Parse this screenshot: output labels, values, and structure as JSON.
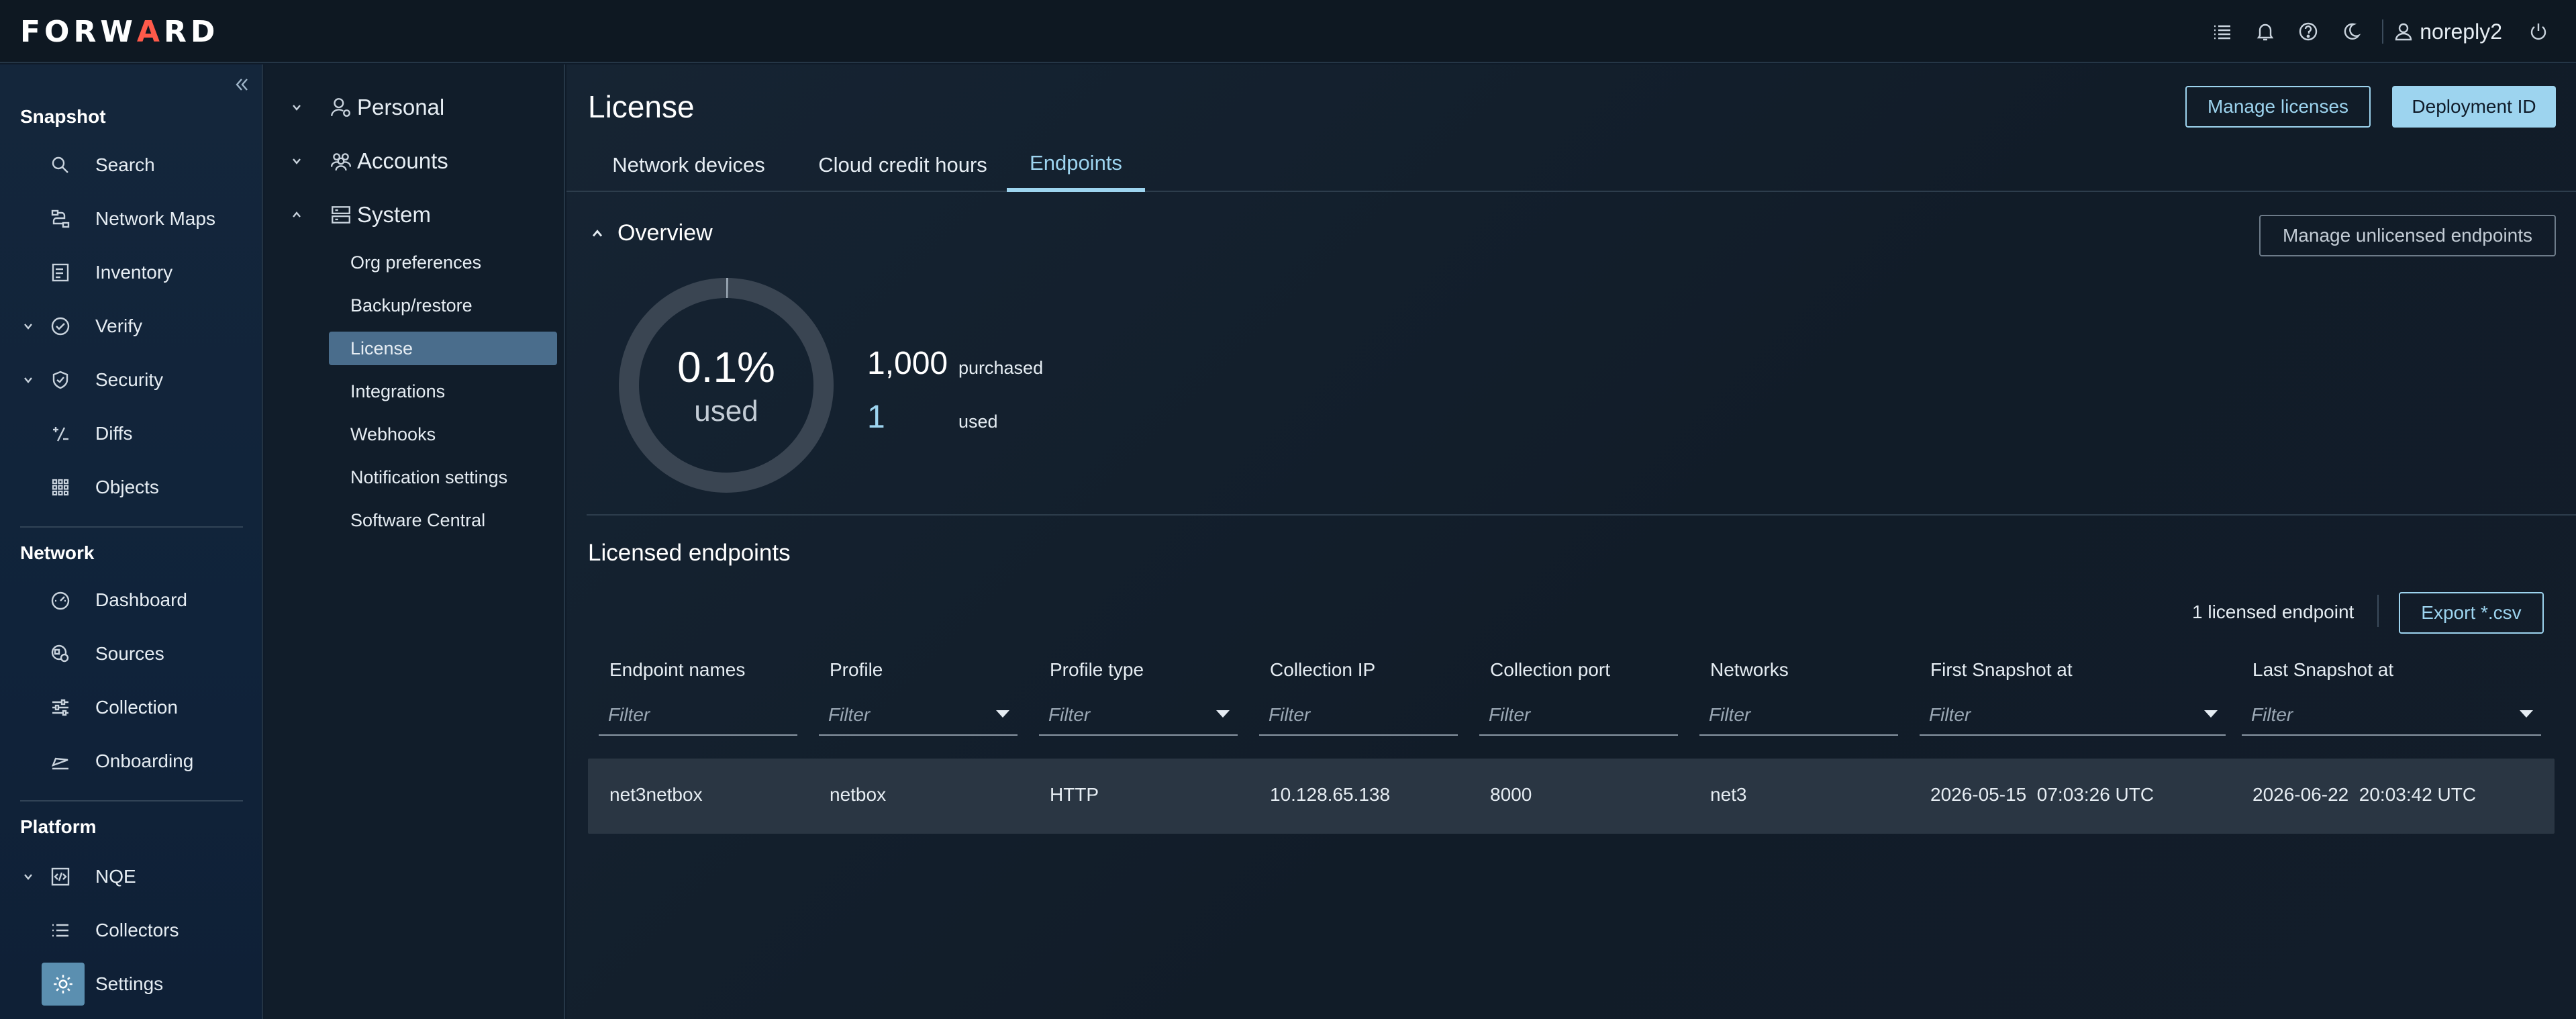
{
  "app": {
    "logo_left": "FORW",
    "logo_mid": "A",
    "logo_right": "RD",
    "user": "noreply2"
  },
  "top_icons": [
    "list-icon",
    "bell-icon",
    "help-icon",
    "moon-icon",
    "user-icon",
    "power-icon"
  ],
  "sidebar": {
    "sections": {
      "snapshot": "Snapshot",
      "network": "Network",
      "platform": "Platform"
    },
    "items": [
      {
        "label": "Search",
        "icon": "search-icon"
      },
      {
        "label": "Network Maps",
        "icon": "network-maps-icon"
      },
      {
        "label": "Inventory",
        "icon": "inventory-icon"
      },
      {
        "label": "Verify",
        "icon": "verify-icon"
      },
      {
        "label": "Security",
        "icon": "shield-icon"
      },
      {
        "label": "Diffs",
        "icon": "diffs-icon"
      },
      {
        "label": "Objects",
        "icon": "objects-grid-icon"
      },
      {
        "label": "Dashboard",
        "icon": "dashboard-gauge-icon"
      },
      {
        "label": "Sources",
        "icon": "sources-icon"
      },
      {
        "label": "Collection",
        "icon": "sliders-icon"
      },
      {
        "label": "Onboarding",
        "icon": "onboarding-icon"
      },
      {
        "label": "NQE",
        "icon": "code-icon"
      },
      {
        "label": "Collectors",
        "icon": "list-icon"
      },
      {
        "label": "Settings",
        "icon": "gear-icon"
      }
    ]
  },
  "settings_nav": {
    "groups": [
      {
        "label": "Personal",
        "icon": "user-gear-icon"
      },
      {
        "label": "Accounts",
        "icon": "users-icon"
      },
      {
        "label": "System",
        "icon": "server-icon"
      }
    ],
    "system_items": [
      "Org preferences",
      "Backup/restore",
      "License",
      "Integrations",
      "Webhooks",
      "Notification settings",
      "Software Central"
    ]
  },
  "main": {
    "title": "License",
    "manage_licenses": "Manage licenses",
    "deployment_id": "Deployment ID",
    "tabs": [
      "Network devices",
      "Cloud credit hours",
      "Endpoints"
    ],
    "active_tab": "Endpoints",
    "overview": {
      "label": "Overview",
      "manage_unlicensed": "Manage unlicensed endpoints",
      "percent": "0.1%",
      "used_word": "used",
      "usage_fraction": 0.001,
      "purchased_value": "1,000",
      "purchased_label": "purchased",
      "used_value": "1",
      "used_label": "used"
    },
    "licensed": {
      "title": "Licensed endpoints",
      "count_text": "1 licensed endpoint",
      "export": "Export *.csv",
      "columns": [
        "Endpoint names",
        "Profile",
        "Profile type",
        "Collection IP",
        "Collection port",
        "Networks",
        "First Snapshot at",
        "Last Snapshot at"
      ],
      "filter_placeholder": "Filter",
      "rows": [
        [
          "net3netbox",
          "netbox",
          "HTTP",
          "10.128.65.138",
          "8000",
          "net3",
          "2026-05-15  07:03:26 UTC",
          "2026-06-22  20:03:42 UTC"
        ]
      ]
    }
  },
  "colors": {
    "accent": "#9dd4ef",
    "logo_accent": "#ff5a4a",
    "active_nav": "#4a6d8c"
  }
}
